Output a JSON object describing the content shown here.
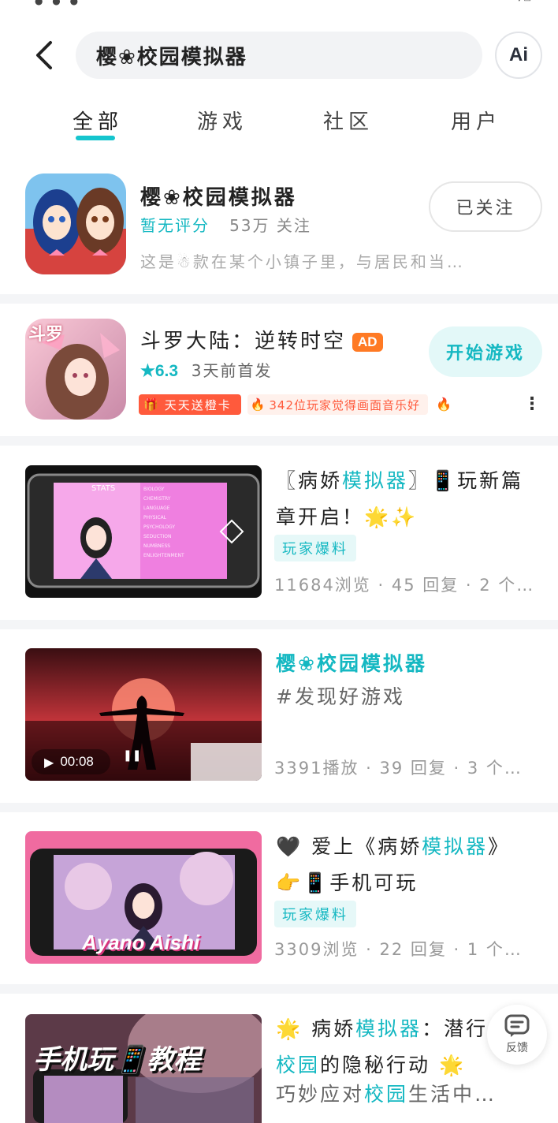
{
  "search": {
    "query": "樱❀校园模拟器",
    "ai_label": "Ai"
  },
  "tabs": [
    {
      "label": "全部",
      "active": true
    },
    {
      "label": "游戏",
      "active": false
    },
    {
      "label": "社区",
      "active": false
    },
    {
      "label": "用户",
      "active": false
    }
  ],
  "game1": {
    "title": "樱❀校园模拟器",
    "rating": "暂无评分",
    "followers": "53万 关注",
    "description": "这是☃款在某个小镇子里，与居民和当…",
    "button": "已关注"
  },
  "game2": {
    "title": "斗罗大陆：逆转时空",
    "ad_badge": "AD",
    "rating": "★6.3",
    "release": "3天前首发",
    "tag1": "天天送橙卡",
    "tag2": "342位玩家觉得画面音乐好",
    "button": "开始游戏",
    "icon_text": "斗罗"
  },
  "posts": [
    {
      "title_parts": [
        "〖病娇",
        "模拟器",
        "〗📱玩新篇章开启！🌟✨"
      ],
      "tag": "玩家爆料",
      "stats": "11684浏览 · 45 回复 · 2 个…",
      "thumb_text": "STATS"
    },
    {
      "title": "樱❀校园模拟器",
      "subtitle": "#发现好游戏",
      "stats": "3391播放 · 39 回复 · 3 个…",
      "duration": "00:08"
    },
    {
      "title_parts": [
        "🖤 爱上《病娇",
        "模拟器",
        "》👉📱手机可玩"
      ],
      "tag": "玩家爆料",
      "stats": "3309浏览 · 22 回复 · 1 个…",
      "thumb_text": "Ayano Aishi"
    },
    {
      "line1_parts": [
        "🌟 病娇",
        "模拟器",
        "：潜行"
      ],
      "line2_parts": [
        "校园",
        "的隐秘行动 🌟"
      ],
      "line3_parts": [
        "巧妙应对",
        "校园",
        "生活中…"
      ],
      "thumb_text": "手机玩📱教程"
    }
  ],
  "feedback_label": "反馈",
  "colors": {
    "accent": "#15c5ce",
    "accent_text": "#15b8c2",
    "ad": "#ff7a24",
    "tag_red": "#ff5a3c"
  }
}
